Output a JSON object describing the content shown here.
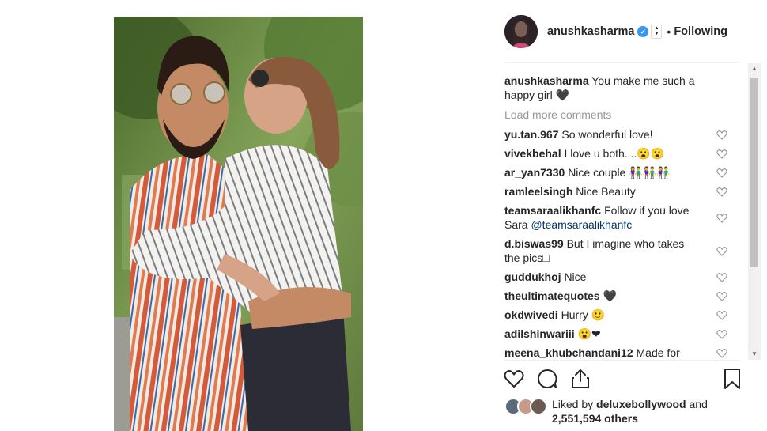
{
  "post": {
    "photo_alt": "Couple hugging photo"
  },
  "header": {
    "username": "anushkasharma",
    "verified_mark": "✓",
    "separator": "•",
    "follow_status": "Following"
  },
  "caption": {
    "username": "anushkasharma",
    "text": "You make me such a happy girl 🖤"
  },
  "load_more": "Load more comments",
  "comments": [
    {
      "username": "yu.tan.967",
      "text": "So wonderful love!",
      "mention": ""
    },
    {
      "username": "vivekbehal",
      "text": "I love u both....😮😮",
      "mention": ""
    },
    {
      "username": "ar_yan7330",
      "text": "Nice couple 👫👫👫",
      "mention": ""
    },
    {
      "username": "ramleelsingh",
      "text": "Nice Beauty",
      "mention": ""
    },
    {
      "username": "teamsaraalikhanfc",
      "text": "Follow if you love Sara",
      "mention": "@teamsaraalikhanfc"
    },
    {
      "username": "d.biswas99",
      "text": "But I imagine who takes the pics□",
      "mention": ""
    },
    {
      "username": "guddukhoj",
      "text": "Nice",
      "mention": ""
    },
    {
      "username": "theultimatequotes",
      "text": "🖤",
      "mention": ""
    },
    {
      "username": "okdwivedi",
      "text": "Hurry 🙂",
      "mention": ""
    },
    {
      "username": "adilshinwariii",
      "text": "😮❤",
      "mention": ""
    },
    {
      "username": "meena_khubchandani12",
      "text": "Made for",
      "mention": ""
    }
  ],
  "icons": {
    "like": "heart-icon",
    "comment": "comment-icon",
    "share": "share-icon",
    "save": "bookmark-icon",
    "comment_like": "small-heart-icon"
  },
  "likes": {
    "prefix": "Liked by",
    "liker": "deluxebollywood",
    "conjunction": "and",
    "others": "2,551,594 others"
  },
  "scrollbar": {
    "up": "▲",
    "down": "▼"
  },
  "colors": {
    "text": "#262626",
    "muted": "#999999",
    "link": "#003569",
    "verified": "#3897f0",
    "divider": "#efefef"
  }
}
